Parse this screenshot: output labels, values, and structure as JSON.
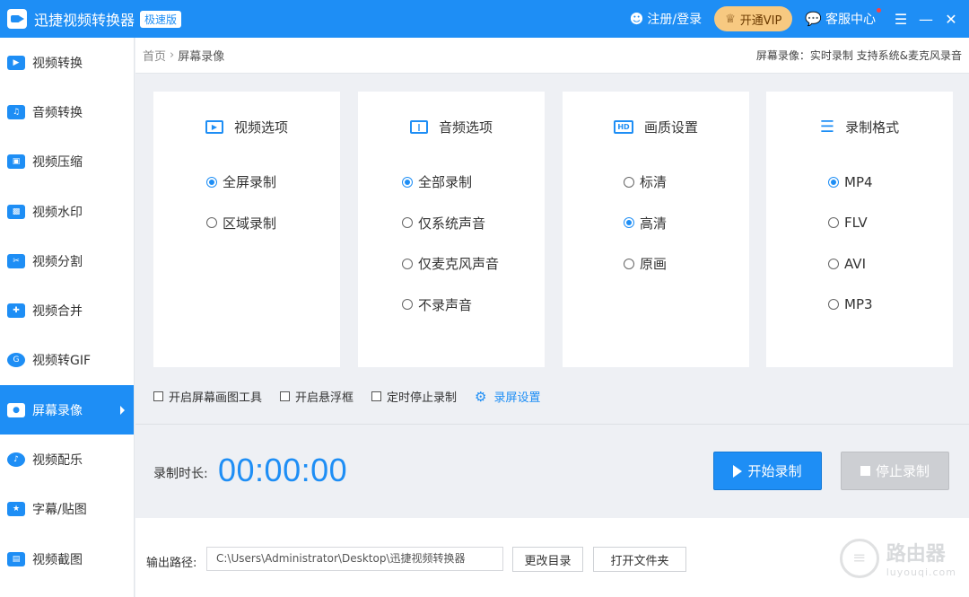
{
  "titlebar": {
    "app_title": "迅捷视频转换器",
    "edition": "极速版",
    "login": "注册/登录",
    "vip": "开通VIP",
    "service": "客服中心"
  },
  "sidebar": {
    "items": [
      {
        "label": "视频转换",
        "icon": "video-convert-icon"
      },
      {
        "label": "音频转换",
        "icon": "audio-convert-icon"
      },
      {
        "label": "视频压缩",
        "icon": "video-compress-icon"
      },
      {
        "label": "视频水印",
        "icon": "video-watermark-icon"
      },
      {
        "label": "视频分割",
        "icon": "video-split-icon"
      },
      {
        "label": "视频合并",
        "icon": "video-merge-icon"
      },
      {
        "label": "视频转GIF",
        "icon": "gif-icon"
      },
      {
        "label": "屏幕录像",
        "icon": "screen-record-icon",
        "active": true
      },
      {
        "label": "视频配乐",
        "icon": "music-icon"
      },
      {
        "label": "字幕/贴图",
        "icon": "subtitle-icon"
      },
      {
        "label": "视频截图",
        "icon": "screenshot-icon"
      }
    ]
  },
  "breadcrumb": {
    "home": "首页",
    "separator": "›",
    "current": "屏幕录像",
    "info": "屏幕录像：实时录制 支持系统&麦克风录音"
  },
  "panels": {
    "video": {
      "title": "视频选项",
      "options": [
        "全屏录制",
        "区域录制"
      ],
      "selected": 0
    },
    "audio": {
      "title": "音频选项",
      "options": [
        "全部录制",
        "仅系统声音",
        "仅麦克风声音",
        "不录声音"
      ],
      "selected": 0
    },
    "quality": {
      "title": "画质设置",
      "icon_text": "HD",
      "options": [
        "标清",
        "高清",
        "原画"
      ],
      "selected": 1
    },
    "format": {
      "title": "录制格式",
      "options": [
        "MP4",
        "FLV",
        "AVI",
        "MP3"
      ],
      "selected": 0
    }
  },
  "checks": {
    "draw_tool": "开启屏幕画图工具",
    "float_box": "开启悬浮框",
    "timed_stop": "定时停止录制",
    "settings": "录屏设置"
  },
  "recording": {
    "duration_label": "录制时长:",
    "duration": "00:00:00",
    "start": "开始录制",
    "stop": "停止录制"
  },
  "output": {
    "label": "输出路径:",
    "path": "C:\\Users\\Administrator\\Desktop\\迅捷视频转换器",
    "change_dir": "更改目录",
    "open_folder": "打开文件夹"
  },
  "watermark": {
    "main": "路由器",
    "sub": "luyouqi.com"
  },
  "colors": {
    "accent": "#1e8ef5",
    "vip": "#f7c981",
    "stop_disabled": "#cdcfd3"
  }
}
